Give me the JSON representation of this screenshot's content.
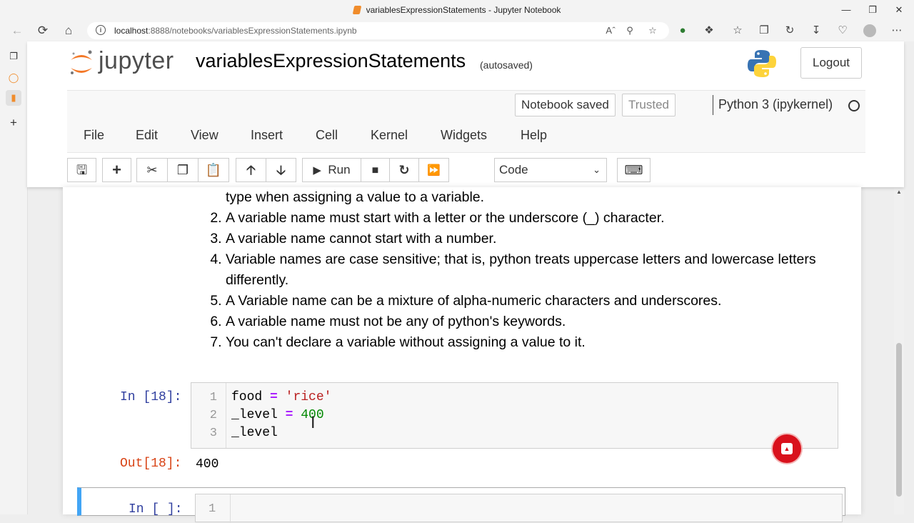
{
  "browser": {
    "window_title": "variablesExpressionStatements - Jupyter Notebook",
    "url_host": "localhost",
    "url_rest": ":8888/notebooks/variablesExpressionStatements.ipynb"
  },
  "header": {
    "logo_text": "jupyter",
    "notebook_title": "variablesExpressionStatements",
    "autosave_status": "(autosaved)",
    "logout_label": "Logout"
  },
  "status": {
    "saved_label": "Notebook saved",
    "trusted_label": "Trusted",
    "kernel_name": "Python 3 (ipykernel)"
  },
  "menu": {
    "items": [
      "File",
      "Edit",
      "View",
      "Insert",
      "Cell",
      "Kernel",
      "Widgets",
      "Help"
    ]
  },
  "toolbar": {
    "run_label": "Run",
    "cell_type": "Code"
  },
  "markdown": {
    "continuation": "type when assigning a value to a variable.",
    "rules": [
      "A variable name must start with a letter or the underscore (_) character.",
      "A variable name cannot start with a number.",
      "Variable names are case sensitive; that is, python treats uppercase letters and lowercase letters differently.",
      "A Variable name can be a mixture of alpha-numeric characters and underscores.",
      "A variable name must not be any of python's keywords.",
      "You can't declare a variable without assigning a value to it."
    ]
  },
  "cell": {
    "in_prompt": "In [18]:",
    "line_numbers": [
      "1",
      "2",
      "3"
    ],
    "line1_var": "food",
    "line1_op": "=",
    "line1_str": "'rice'",
    "line2_var": "_level",
    "line2_op": "=",
    "line2_num": "400",
    "line3": "_level",
    "out_prompt": "Out[18]:",
    "output": "400"
  },
  "next_cell": {
    "in_prompt": "In [ ]:",
    "line_number": "1"
  },
  "colors": {
    "accent_blue": "#42a5f5",
    "in_prompt": "#303f9f",
    "out_prompt": "#d84315",
    "scroll_button": "#d9111c"
  }
}
